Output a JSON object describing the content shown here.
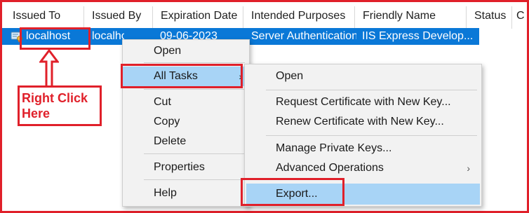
{
  "columns": [
    "Issued To",
    "Issued By",
    "Expiration Date",
    "Intended Purposes",
    "Friendly Name",
    "Status",
    "C"
  ],
  "row": {
    "issued_to": "localhost",
    "issued_by": "localhost",
    "expiration": "09-06-2023",
    "purposes": "Server Authentication",
    "friendly_name": "IIS Express Develop..."
  },
  "menu": {
    "items": [
      "Open",
      "All Tasks",
      "Cut",
      "Copy",
      "Delete",
      "Properties",
      "Help"
    ],
    "submenu_arrow": "›"
  },
  "submenu": {
    "items": [
      "Open",
      "Request Certificate with New Key...",
      "Renew Certificate with New Key...",
      "Manage Private Keys...",
      "Advanced Operations",
      "Export..."
    ],
    "submenu_arrow": "›"
  },
  "annotation": {
    "line1": "Right Click",
    "line2": "Here"
  },
  "colors": {
    "highlight": "#e0202a",
    "selection": "#0a78d7",
    "menu_hover": "#a8d4f6"
  }
}
